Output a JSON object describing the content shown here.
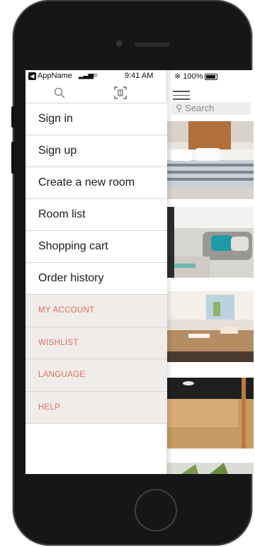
{
  "status_bar": {
    "app_name": "AppName",
    "time": "9:41 AM",
    "battery": "100%",
    "signal_icon": "signal-bars-icon",
    "wifi_icon": "wifi-icon",
    "bluetooth_icon": "bluetooth-icon"
  },
  "drawer": {
    "tools": [
      {
        "name": "search-icon"
      },
      {
        "name": "scan-icon"
      }
    ],
    "main_items": [
      {
        "label": "Sign in"
      },
      {
        "label": "Sign up"
      },
      {
        "label": "Create a new room"
      },
      {
        "label": "Room list"
      },
      {
        "label": "Shopping cart"
      },
      {
        "label": "Order history"
      }
    ],
    "secondary_items": [
      {
        "label": "MY ACCOUNT"
      },
      {
        "label": "WISHLIST"
      },
      {
        "label": "LANGUAGE"
      },
      {
        "label": "HELP"
      }
    ]
  },
  "content": {
    "search_placeholder": "Search",
    "photos": [
      {
        "name": "bedroom-photo"
      },
      {
        "name": "living-room-photo"
      },
      {
        "name": "dining-room-photo"
      },
      {
        "name": "hallway-photo"
      },
      {
        "name": "plant-photo"
      }
    ]
  },
  "colors": {
    "accent": "#e0705a",
    "secondary_bg": "#efecea",
    "divider": "#d6d6d6"
  }
}
